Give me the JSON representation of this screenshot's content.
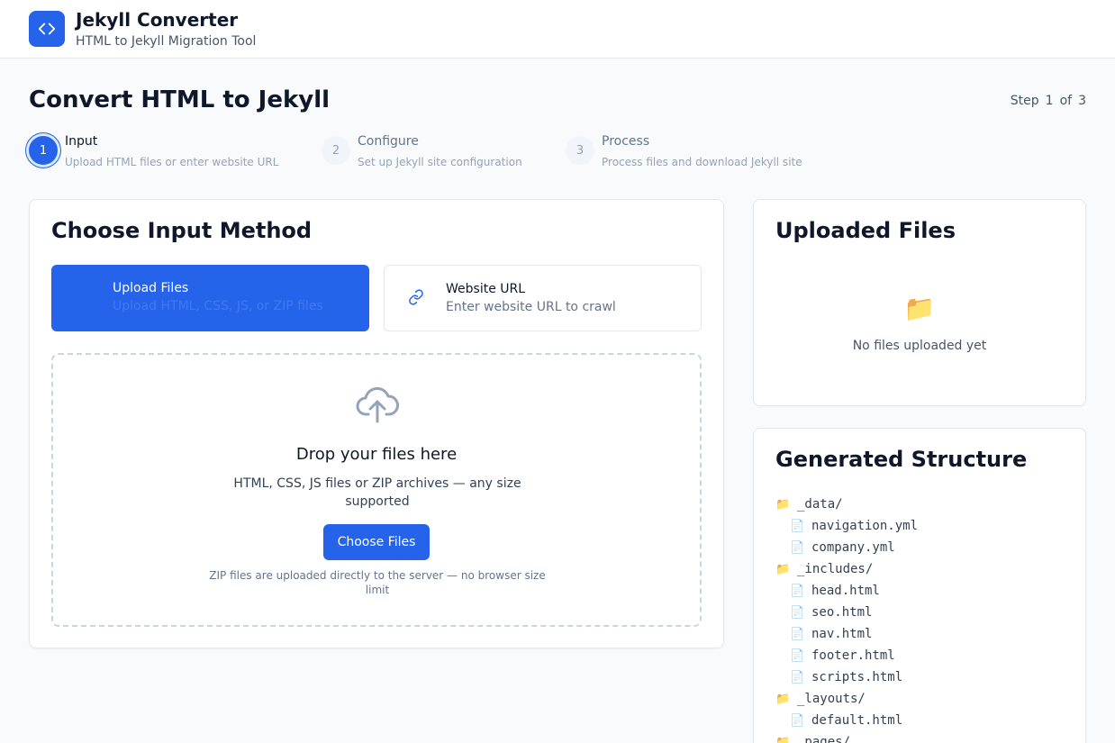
{
  "header": {
    "title": "Jekyll Converter",
    "subtitle": "HTML to Jekyll Migration Tool",
    "logo_icon": "code-icon",
    "brand_color": "#2563eb"
  },
  "page": {
    "title": "Convert HTML to Jekyll",
    "step_word": "Step",
    "step_current": "1",
    "step_of": "of",
    "step_total": "3"
  },
  "steps": [
    {
      "number": "1",
      "title": "Input",
      "description": "Upload HTML files or enter website URL",
      "active": true
    },
    {
      "number": "2",
      "title": "Configure",
      "description": "Set up Jekyll site configuration",
      "active": false
    },
    {
      "number": "3",
      "title": "Process",
      "description": "Process files and download Jekyll site",
      "active": false
    }
  ],
  "input_card": {
    "title": "Choose Input Method",
    "methods": [
      {
        "label": "Upload Files",
        "description": "Upload HTML, CSS, JS, or ZIP files",
        "selected": true,
        "icon": "upload-icon"
      },
      {
        "label": "Website URL",
        "description": "Enter website URL to crawl",
        "selected": false,
        "icon": "link-icon"
      }
    ],
    "dropzone": {
      "icon": "cloud-upload-icon",
      "title": "Drop your files here",
      "description": "HTML, CSS, JS files or ZIP archives — any size supported",
      "button_label": "Choose Files",
      "note": "ZIP files are uploaded directly to the server — no browser size limit"
    }
  },
  "uploaded_card": {
    "title": "Uploaded Files",
    "empty_icon": "📁",
    "empty_text": "No files uploaded yet"
  },
  "structure_card": {
    "title": "Generated Structure",
    "folder_icon": "📁",
    "file_icon": "📄",
    "items": [
      {
        "type": "folder",
        "name": "_data/"
      },
      {
        "type": "file",
        "name": "navigation.yml"
      },
      {
        "type": "file",
        "name": "company.yml"
      },
      {
        "type": "folder",
        "name": "_includes/"
      },
      {
        "type": "file",
        "name": "head.html"
      },
      {
        "type": "file",
        "name": "seo.html"
      },
      {
        "type": "file",
        "name": "nav.html"
      },
      {
        "type": "file",
        "name": "footer.html"
      },
      {
        "type": "file",
        "name": "scripts.html"
      },
      {
        "type": "folder",
        "name": "_layouts/"
      },
      {
        "type": "file",
        "name": "default.html"
      },
      {
        "type": "folder",
        "name": "_pages/"
      }
    ]
  }
}
